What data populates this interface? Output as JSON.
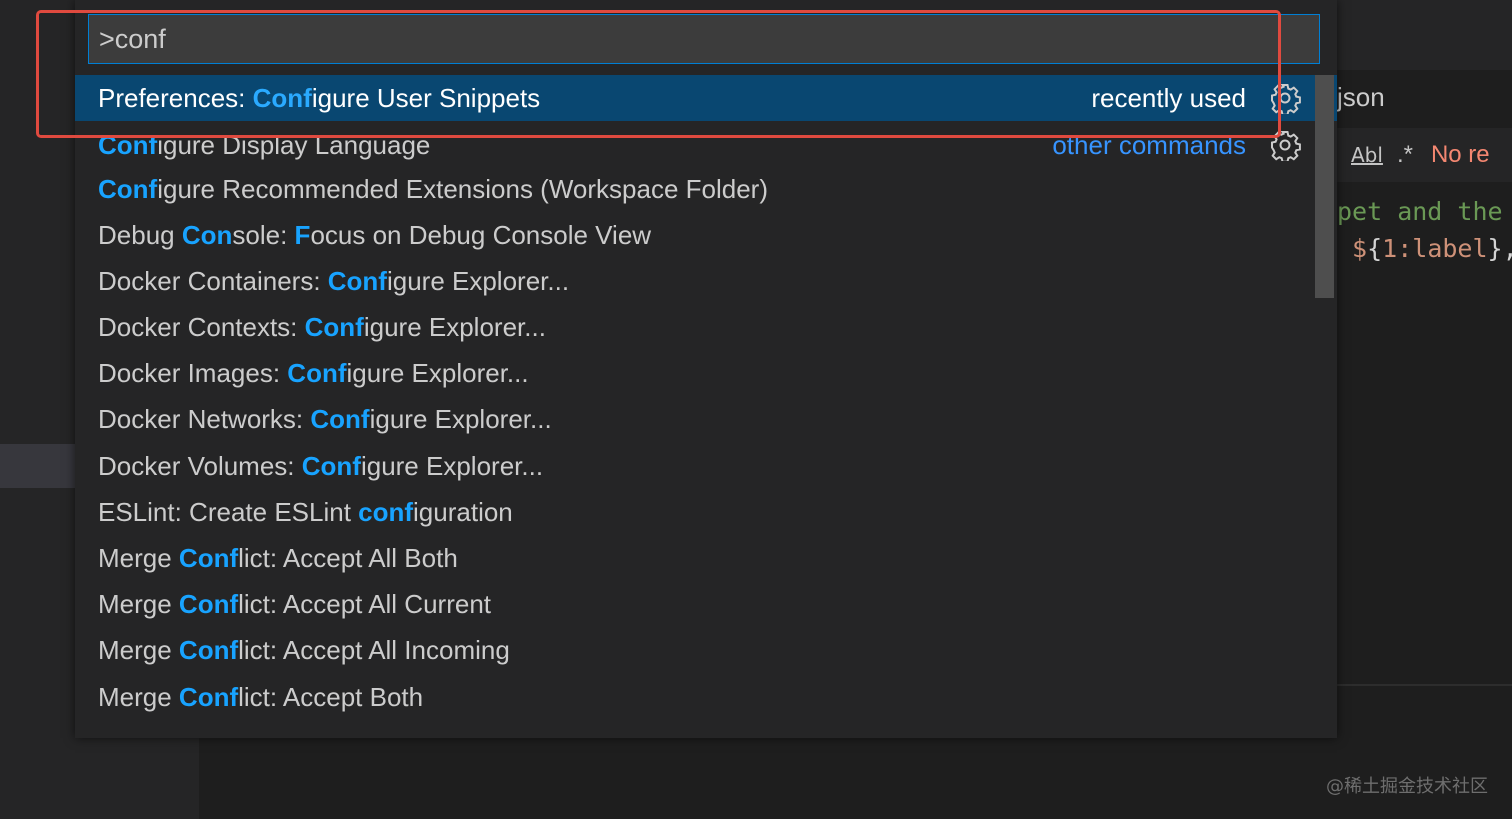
{
  "palette": {
    "query": ">conf",
    "items": [
      {
        "segments": [
          {
            "t": "Preferences: ",
            "h": false
          },
          {
            "t": "Conf",
            "h": true
          },
          {
            "t": "igure User Snippets",
            "h": false
          }
        ],
        "group": "recently used",
        "gear": true,
        "selected": true
      },
      {
        "segments": [
          {
            "t": "Conf",
            "h": true
          },
          {
            "t": "igure Display Language",
            "h": false
          }
        ],
        "group": "other commands",
        "gear": true,
        "selected": false
      },
      {
        "segments": [
          {
            "t": "Conf",
            "h": true
          },
          {
            "t": "igure Recommended Extensions (Workspace Folder)",
            "h": false
          }
        ]
      },
      {
        "segments": [
          {
            "t": "Debug ",
            "h": false
          },
          {
            "t": "Con",
            "h": true
          },
          {
            "t": "sole: ",
            "h": false
          },
          {
            "t": "F",
            "h": true
          },
          {
            "t": "ocus on Debug Console View",
            "h": false
          }
        ]
      },
      {
        "segments": [
          {
            "t": "Docker Containers: ",
            "h": false
          },
          {
            "t": "Conf",
            "h": true
          },
          {
            "t": "igure Explorer...",
            "h": false
          }
        ]
      },
      {
        "segments": [
          {
            "t": "Docker Contexts: ",
            "h": false
          },
          {
            "t": "Conf",
            "h": true
          },
          {
            "t": "igure Explorer...",
            "h": false
          }
        ]
      },
      {
        "segments": [
          {
            "t": "Docker Images: ",
            "h": false
          },
          {
            "t": "Conf",
            "h": true
          },
          {
            "t": "igure Explorer...",
            "h": false
          }
        ]
      },
      {
        "segments": [
          {
            "t": "Docker Networks: ",
            "h": false
          },
          {
            "t": "Conf",
            "h": true
          },
          {
            "t": "igure Explorer...",
            "h": false
          }
        ]
      },
      {
        "segments": [
          {
            "t": "Docker Volumes: ",
            "h": false
          },
          {
            "t": "Conf",
            "h": true
          },
          {
            "t": "igure Explorer...",
            "h": false
          }
        ]
      },
      {
        "segments": [
          {
            "t": "ESLint: Create ESLint ",
            "h": false
          },
          {
            "t": "conf",
            "h": true
          },
          {
            "t": "iguration",
            "h": false
          }
        ]
      },
      {
        "segments": [
          {
            "t": "Merge ",
            "h": false
          },
          {
            "t": "Conf",
            "h": true
          },
          {
            "t": "lict: Accept All Both",
            "h": false
          }
        ]
      },
      {
        "segments": [
          {
            "t": "Merge ",
            "h": false
          },
          {
            "t": "Conf",
            "h": true
          },
          {
            "t": "lict: Accept All Current",
            "h": false
          }
        ]
      },
      {
        "segments": [
          {
            "t": "Merge ",
            "h": false
          },
          {
            "t": "Conf",
            "h": true
          },
          {
            "t": "lict: Accept All Incoming",
            "h": false
          }
        ]
      },
      {
        "segments": [
          {
            "t": "Merge ",
            "h": false
          },
          {
            "t": "Conf",
            "h": true
          },
          {
            "t": "lict: Accept Both",
            "h": false
          }
        ]
      }
    ]
  },
  "editor": {
    "tab_label": "json",
    "find": {
      "case_label": "Abl",
      "regex_label": ".*",
      "result": "No re"
    },
    "code_line1": "pet and the",
    "code_line2_prefix": " $",
    "code_line2_brace_open": "{",
    "code_line2_text": "1:label",
    "code_line2_brace_close": "},"
  },
  "watermark": "@稀土掘金技术社区",
  "colors": {
    "highlight": "#18a3ff",
    "selected_bg": "#094771",
    "input_border": "#007fd4",
    "annotation": "#e04a3f",
    "other_commands": "#3794ff"
  },
  "icons": {
    "gear": "gear-icon"
  }
}
